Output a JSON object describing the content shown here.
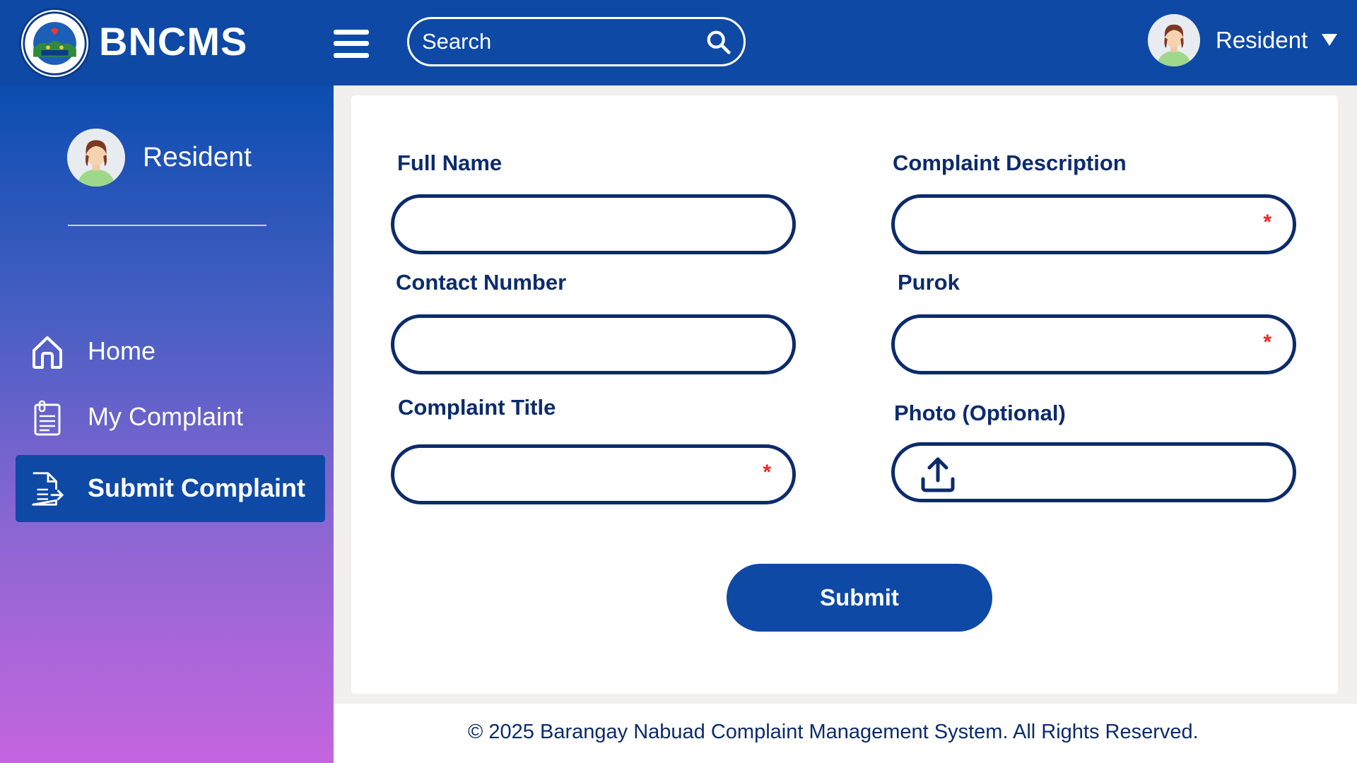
{
  "app": {
    "brand": "BNCMS",
    "logo_text": [
      "BARANGAY NABUAD",
      "INABANGA , BOHOL"
    ],
    "accent_color": "#0e49a6",
    "text_color": "#0c2b6b"
  },
  "header": {
    "search_placeholder": "Search",
    "search_icon": "search-icon",
    "menu_icon": "hamburger-menu-icon",
    "user_label": "Resident",
    "user_menu_icon": "caret-down-icon"
  },
  "sidebar": {
    "user_label": "Resident",
    "items": [
      {
        "label": "Home",
        "icon": "home-icon",
        "active": false
      },
      {
        "label": "My Complaint",
        "icon": "clipboard-icon",
        "active": false
      },
      {
        "label": "Submit Complaint",
        "icon": "submit-document-icon",
        "active": true
      }
    ]
  },
  "form": {
    "full_name": {
      "label": "Full Name",
      "value": "",
      "required": false
    },
    "contact_number": {
      "label": "Contact Number",
      "value": "",
      "required": false
    },
    "complaint_title": {
      "label": "Complaint Title",
      "value": "",
      "required": true
    },
    "complaint_description": {
      "label": "Complaint Description",
      "value": "",
      "required": true
    },
    "purok": {
      "label": "Purok",
      "value": "",
      "required": true
    },
    "photo": {
      "label": "Photo (Optional)",
      "icon": "upload-icon"
    },
    "required_marker": "*",
    "submit_label": "Submit"
  },
  "footer": {
    "text": "© 2025 Barangay Nabuad Complaint Management System. All Rights Reserved."
  }
}
